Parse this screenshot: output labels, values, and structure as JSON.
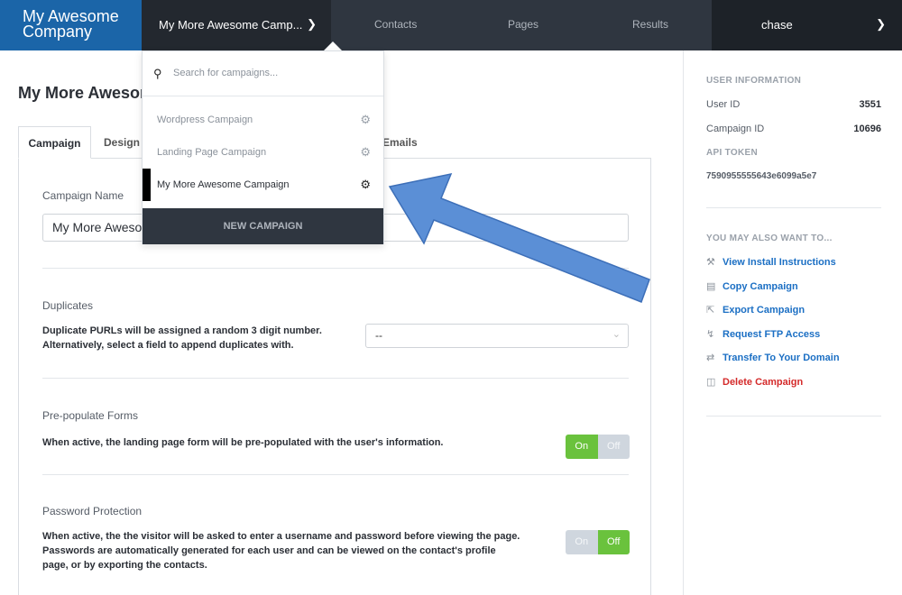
{
  "brand": {
    "line1": "My Awesome",
    "line2": "Company"
  },
  "topnav": {
    "campaign_selector": "My More Awesome Camp...",
    "links": [
      "Contacts",
      "Pages",
      "Results"
    ],
    "user": "chase"
  },
  "page": {
    "title": "My More Awesome Campaign"
  },
  "tabs": {
    "campaign": "Campaign",
    "design": "Design",
    "emails": "Emails"
  },
  "form": {
    "campaign_name_label": "Campaign Name",
    "campaign_name_value": "My More Awesome Campaign",
    "duplicates_label": "Duplicates",
    "duplicates_desc_1": "Duplicate PURLs will be assigned a random 3 digit number.",
    "duplicates_desc_2": "Alternatively, select a field to append duplicates with.",
    "duplicates_select": "--",
    "prepopulate_label": "Pre-populate Forms",
    "prepopulate_desc": "When active, the landing page form will be pre-populated with the user's information.",
    "password_label": "Password Protection",
    "password_desc_1": "When active, the the visitor will be asked to enter a username and password before viewing the page.",
    "password_desc_2": "Passwords are automatically generated for each user and can be viewed on the contact's profile",
    "password_desc_3": "page, or by exporting the contacts.",
    "toggle_on": "On",
    "toggle_off": "Off",
    "prepopulate_state": "On",
    "password_state": "Off"
  },
  "sidebar": {
    "user_info_heading": "USER INFORMATION",
    "user_id_label": "User ID",
    "user_id_value": "3551",
    "campaign_id_label": "Campaign ID",
    "campaign_id_value": "10696",
    "api_token_label": "API TOKEN",
    "api_token_value": "7590955555643e6099a5e7",
    "also_heading": "YOU MAY ALSO WANT TO...",
    "links": [
      {
        "label": "View Install Instructions",
        "icon": "wrench-icon"
      },
      {
        "label": "Copy Campaign",
        "icon": "document-icon"
      },
      {
        "label": "Export Campaign",
        "icon": "export-icon"
      },
      {
        "label": "Request FTP Access",
        "icon": "lightning-icon"
      },
      {
        "label": "Transfer To Your Domain",
        "icon": "transfer-icon"
      },
      {
        "label": "Delete Campaign",
        "icon": "trash-icon"
      }
    ]
  },
  "dropdown": {
    "search_placeholder": "Search for campaigns...",
    "items": [
      "Wordpress Campaign",
      "Landing Page Campaign",
      "My More Awesome Campaign"
    ],
    "current_item": "My More Awesome Campaign",
    "new_campaign": "NEW CAMPAIGN"
  },
  "colors": {
    "brand_blue": "#1b65a8",
    "nav_dark": "#2f3640",
    "toggle_green": "#6ac23d",
    "link_blue": "#1b6fc4",
    "danger_red": "#d42a2a",
    "annotation_arrow": "#5b8fd6"
  }
}
